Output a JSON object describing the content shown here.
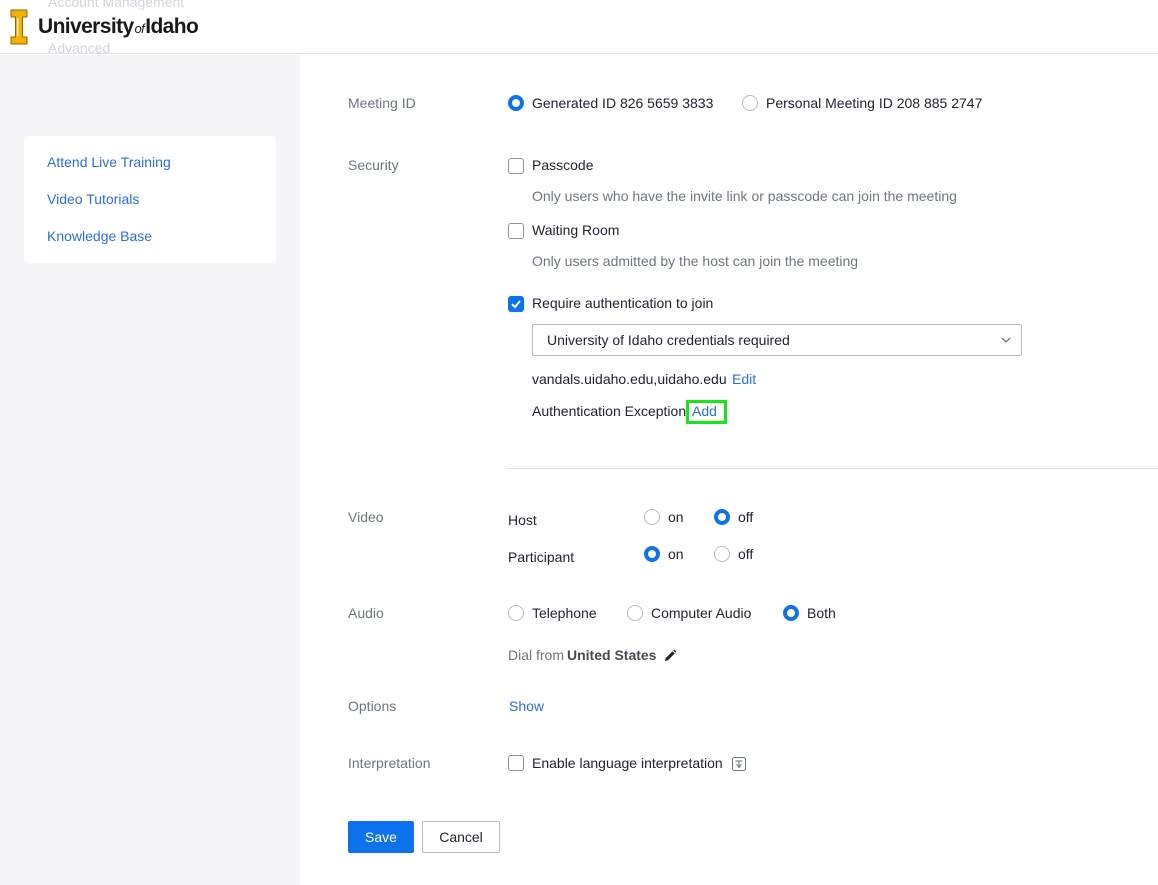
{
  "header": {
    "logo_main": "University",
    "logo_of": "of",
    "logo_end": "Idaho",
    "ghost_top": "Account Management",
    "ghost_bottom": "Advanced"
  },
  "sidebar": {
    "items": [
      {
        "label": "Attend Live Training"
      },
      {
        "label": "Video Tutorials"
      },
      {
        "label": "Knowledge Base"
      }
    ]
  },
  "meeting_id": {
    "label": "Meeting ID",
    "generated": "Generated ID 826 5659 3833",
    "personal": "Personal Meeting ID 208 885 2747",
    "selected": "generated"
  },
  "security": {
    "label": "Security",
    "passcode": {
      "label": "Passcode",
      "checked": false,
      "hint": "Only users who have the invite link or passcode can join the meeting"
    },
    "waiting_room": {
      "label": "Waiting Room",
      "checked": false,
      "hint": "Only users admitted by the host can join the meeting"
    },
    "require_auth": {
      "label": "Require authentication to join",
      "checked": true
    },
    "auth_select": "University of Idaho credentials required",
    "domains": "vandals.uidaho.edu,uidaho.edu",
    "edit_label": "Edit",
    "exception_label": "Authentication Exception",
    "add_label": "Add"
  },
  "video": {
    "label": "Video",
    "host_label": "Host",
    "participant_label": "Participant",
    "on_label": "on",
    "off_label": "off",
    "host_value": "off",
    "participant_value": "on"
  },
  "audio": {
    "label": "Audio",
    "telephone": "Telephone",
    "computer": "Computer Audio",
    "both": "Both",
    "selected": "both",
    "dial_from": "Dial from",
    "country": "United States"
  },
  "options": {
    "label": "Options",
    "show": "Show"
  },
  "interpretation": {
    "label": "Interpretation",
    "enable": "Enable language interpretation",
    "checked": false
  },
  "actions": {
    "save": "Save",
    "cancel": "Cancel"
  },
  "colors": {
    "accent": "#0e72ed",
    "link": "#2d6fd0",
    "highlight": "#19e619",
    "brand_gold": "#f1b300"
  }
}
